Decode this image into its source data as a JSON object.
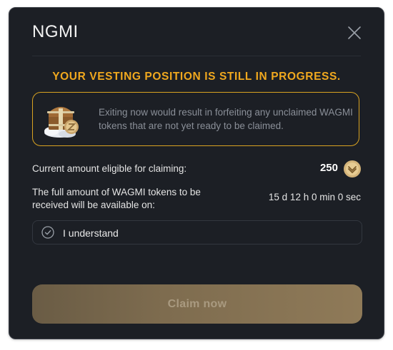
{
  "modal": {
    "title": "NGMI",
    "close_icon": "close-icon"
  },
  "warning": {
    "title": "YOUR VESTING POSITION IS STILL IN PROGRESS.",
    "message": "Exiting now would result in forfeiting any unclaimed WAGMI tokens that are not yet ready to be claimed.",
    "illustration_icon": "treasure-chest-icon",
    "accent_color": "#f0a81e"
  },
  "eligible": {
    "label": "Current amount eligible for claiming:",
    "value": "250",
    "token_icon": "wagmi-token-icon"
  },
  "full_amount": {
    "label": "The full amount of WAGMI tokens to be received will be available on:",
    "countdown": "15 d 12 h 0 min 0 sec"
  },
  "confirm": {
    "label": "I understand",
    "checked": false,
    "icon": "check-circle-icon"
  },
  "claim_button": {
    "label": "Claim now",
    "disabled": true
  }
}
